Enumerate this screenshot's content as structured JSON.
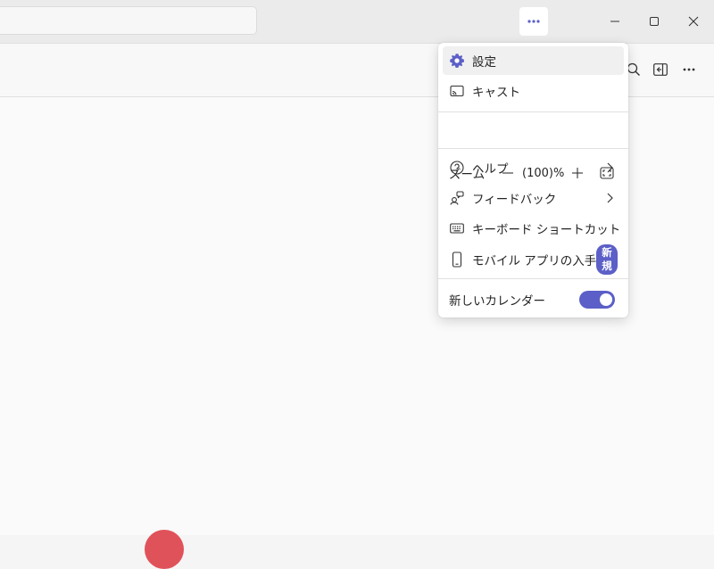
{
  "titlebar": {
    "more_icon": "more-horizontal-icon",
    "window_controls": [
      "minimize-icon",
      "maximize-icon",
      "close-icon"
    ]
  },
  "toolbar": {
    "icons": [
      "search-icon",
      "panel-icon",
      "more-horizontal-icon"
    ]
  },
  "menu": {
    "settings_label": "設定",
    "cast_label": "キャスト",
    "zoom_label": "ズーム",
    "zoom_value": "(100)%",
    "help_label": "ヘルプ",
    "feedback_label": "フィードバック",
    "shortcuts_label": "キーボード ショートカット",
    "mobile_app_label": "モバイル アプリの入手",
    "mobile_app_badge": "新規",
    "new_calendar_label": "新しいカレンダー",
    "new_calendar_enabled": true
  },
  "colors": {
    "accent": "#5b5fc7"
  }
}
